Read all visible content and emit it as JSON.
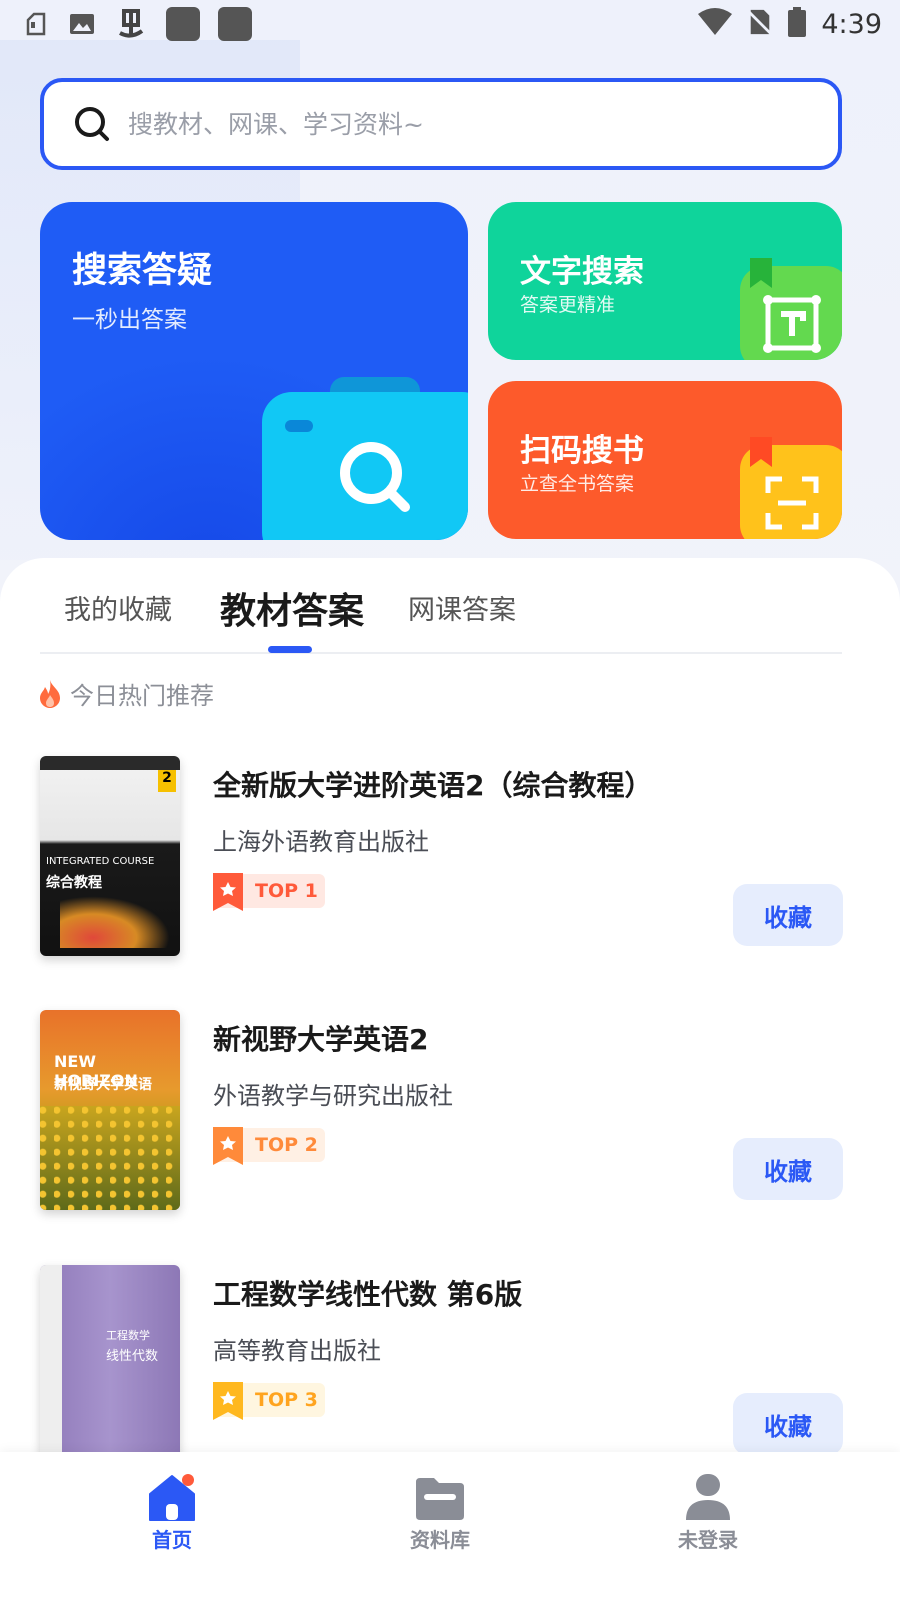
{
  "status_bar": {
    "time": "4:39"
  },
  "search": {
    "placeholder": "搜教材、网课、学习资料~"
  },
  "cards": {
    "photo_search": {
      "title": "搜索答疑",
      "subtitle": "一秒出答案"
    },
    "text_search": {
      "title": "文字搜索",
      "subtitle": "答案更精准"
    },
    "scan_book": {
      "title": "扫码搜书",
      "subtitle": "立查全书答案"
    }
  },
  "tabs": [
    {
      "label": "我的收藏"
    },
    {
      "label": "教材答案"
    },
    {
      "label": "网课答案"
    }
  ],
  "hot_section": {
    "label": "今日热门推荐"
  },
  "books": [
    {
      "title": "全新版大学进阶英语2（综合教程）",
      "publisher": "上海外语教育出版社",
      "rank": "TOP 1",
      "favorite_label": "收藏",
      "cover_text": "INTEGRATED COURSE",
      "cover_subtext": "综合教程"
    },
    {
      "title": "新视野大学英语2",
      "publisher": "外语教学与研究出版社",
      "rank": "TOP 2",
      "favorite_label": "收藏",
      "cover_text": "NEW HORIZON",
      "cover_subtext": "新视野大学英语"
    },
    {
      "title": "工程数学线性代数 第6版",
      "publisher": "高等教育出版社",
      "rank": "TOP 3",
      "favorite_label": "收藏",
      "cover_text": "工程数学",
      "cover_subtext": "线性代数"
    }
  ],
  "bottom_nav": [
    {
      "label": "首页"
    },
    {
      "label": "资料库"
    },
    {
      "label": "未登录"
    }
  ],
  "colors": {
    "accent": "#2b58f5",
    "card_blue": "#1f5cf5",
    "card_green": "#0fd49b",
    "card_orange": "#fd5a2b",
    "rank1": "#ff5a3a",
    "rank2": "#ff8a3a",
    "rank3": "#ffb81f"
  }
}
